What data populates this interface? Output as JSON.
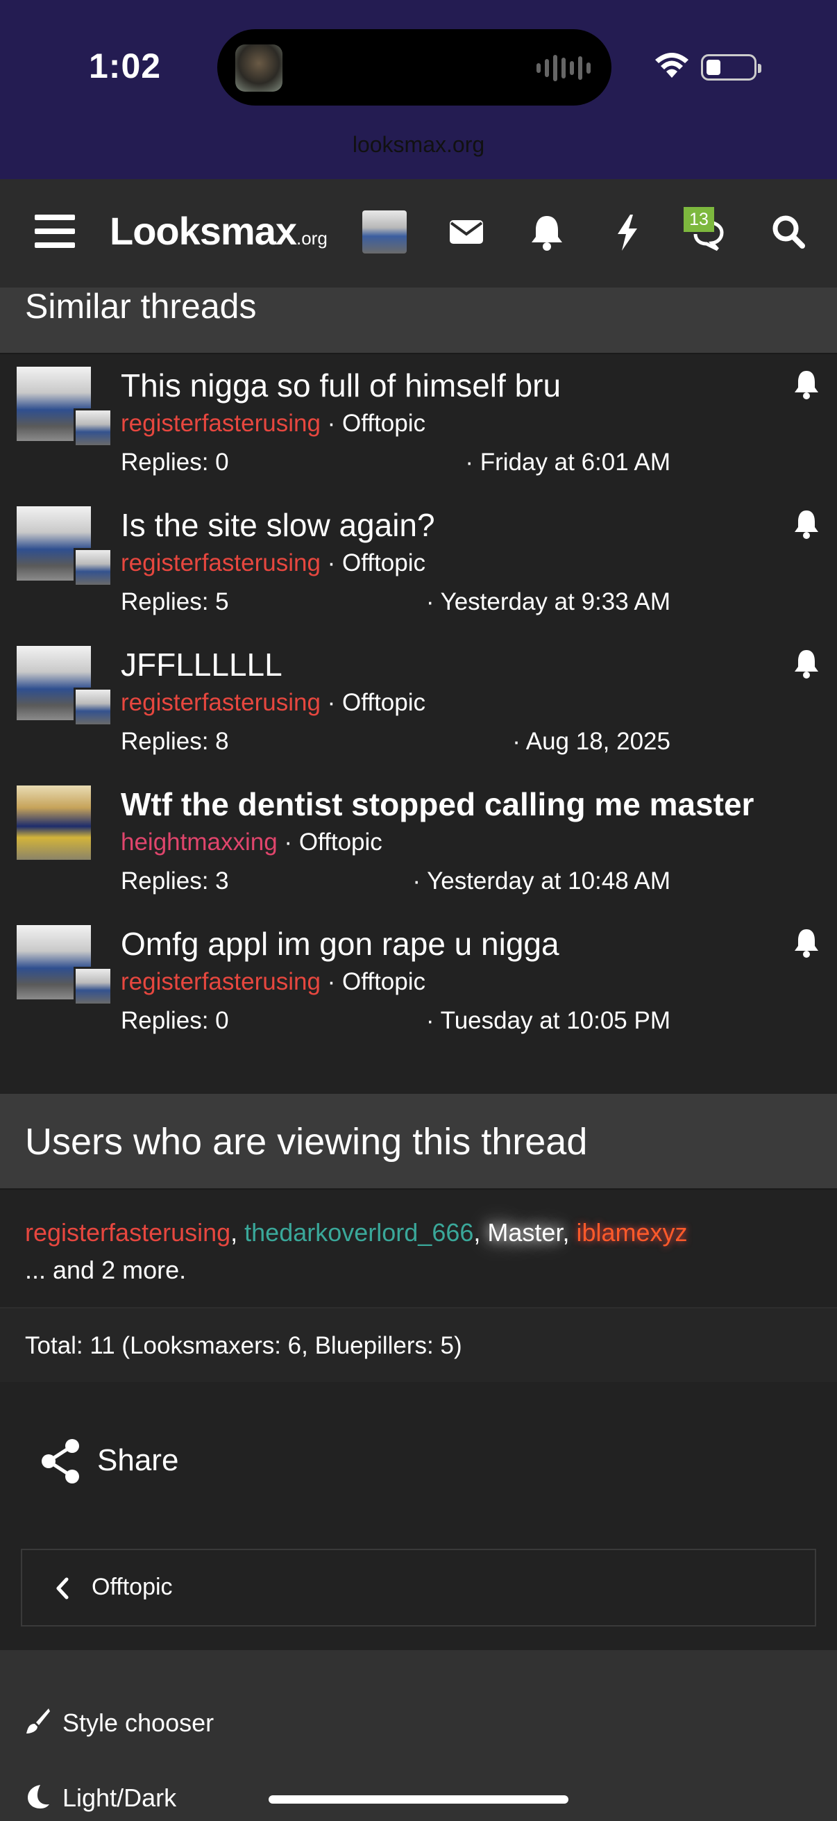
{
  "status_bar": {
    "time": "1:02",
    "url": "looksmax.org"
  },
  "navbar": {
    "logo_main": "Looksmax",
    "logo_suffix": ".org",
    "badge_count": "13",
    "icons": [
      "menu-icon",
      "avatar",
      "mail-icon",
      "bell-icon",
      "bolt-icon",
      "chat-icon",
      "search-icon"
    ]
  },
  "similar_threads": {
    "heading": "Similar threads",
    "items": [
      {
        "title": "This nigga so full of himself bru",
        "author": "registerfasterusing",
        "forum": "Offtopic",
        "replies": "Replies: 0",
        "date": "Friday at 6:01 AM",
        "bold": false,
        "watched": true
      },
      {
        "title": "Is the site slow again?",
        "author": "registerfasterusing",
        "forum": "Offtopic",
        "replies": "Replies: 5",
        "date": "Yesterday at 9:33 AM",
        "bold": false,
        "watched": true
      },
      {
        "title": "JFFLLLLLL",
        "author": "registerfasterusing",
        "forum": "Offtopic",
        "replies": "Replies: 8",
        "date": "Aug 18, 2025",
        "bold": false,
        "watched": true
      },
      {
        "title": "Wtf the dentist stopped calling me master",
        "author": "heightmaxxing",
        "forum": "Offtopic",
        "replies": "Replies: 3",
        "date": "Yesterday at 10:48 AM",
        "bold": true,
        "watched": false
      },
      {
        "title": "Omfg appl im gon rape u nigga",
        "author": "registerfasterusing",
        "forum": "Offtopic",
        "replies": "Replies: 0",
        "date": "Tuesday at 10:05 PM",
        "bold": false,
        "watched": true
      }
    ]
  },
  "viewers": {
    "heading": "Users who are viewing this thread",
    "users": [
      "registerfasterusing",
      "thedarkoverlord_666",
      "Master",
      "iblamexyz"
    ],
    "separator": ", ",
    "more": "... and 2 more.",
    "total": "Total: 11 (Looksmaxers: 6, Bluepillers: 5)"
  },
  "share_label": "Share",
  "breadcrumb": {
    "label": "Offtopic"
  },
  "footer": {
    "style_chooser": "Style chooser",
    "light_dark": "Light/Dark"
  },
  "colors": {
    "status_bg": "#241c52",
    "author_red": "#e7473f",
    "author_pink": "#e0456c",
    "user_teal": "#3aa89a",
    "badge_green": "#7db83e"
  }
}
